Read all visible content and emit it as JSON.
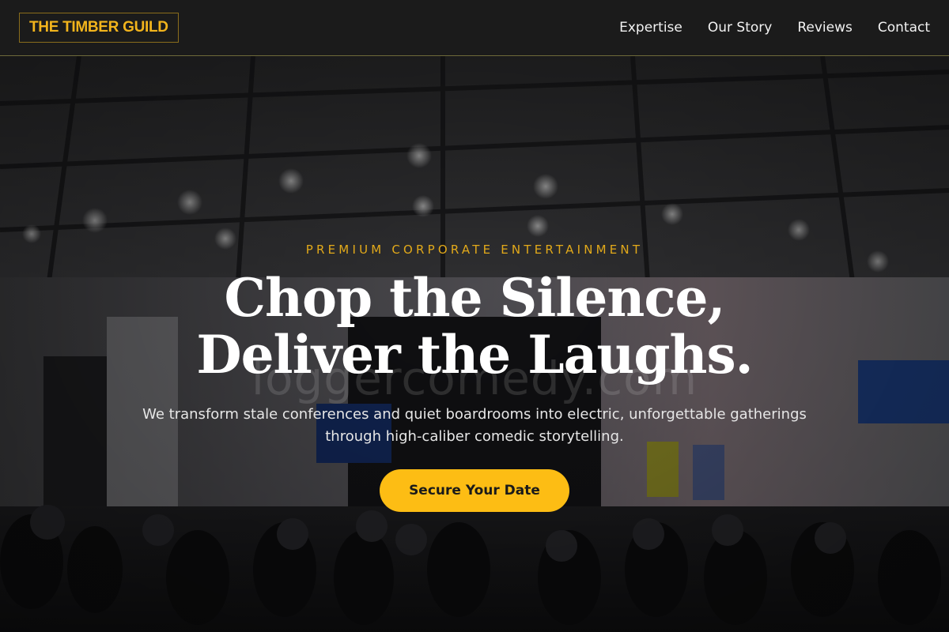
{
  "brand": {
    "name": "THE TIMBER GUILD",
    "accent": "#f2b41c"
  },
  "nav": {
    "items": [
      {
        "label": "Expertise"
      },
      {
        "label": "Our Story"
      },
      {
        "label": "Reviews"
      },
      {
        "label": "Contact"
      }
    ]
  },
  "hero": {
    "eyebrow": "PREMIUM CORPORATE ENTERTAINMENT",
    "headline": "Chop the Silence, Deliver the Laughs.",
    "watermark": "loggercomedy.com",
    "subtext": "We transform stale conferences and quiet boardrooms into electric, unforgettable gatherings through high-caliber comedic storytelling.",
    "cta_label": "Secure Your Date",
    "cta_color": "#fdbd14"
  }
}
